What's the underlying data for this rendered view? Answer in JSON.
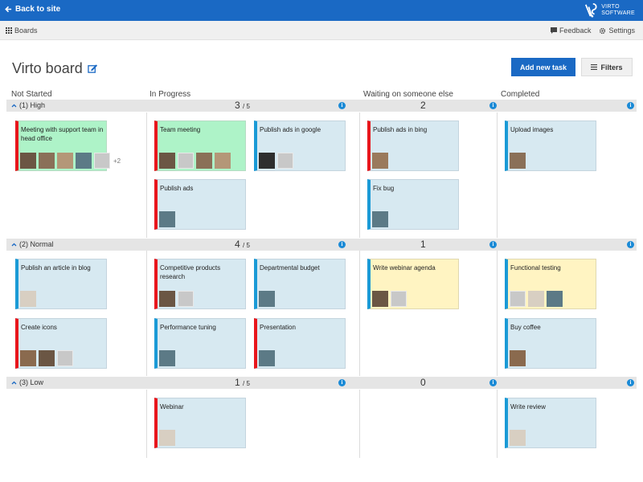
{
  "topbar": {
    "back_label": "Back to site",
    "logo_line1": "VIRTO",
    "logo_line2": "SOFTWARE",
    "color": "#1a69c4"
  },
  "subbar": {
    "boards_label": "Boards",
    "feedback_label": "Feedback",
    "settings_label": "Settings"
  },
  "board": {
    "title": "Virto board",
    "add_task_label": "Add new task",
    "filters_label": "Filters"
  },
  "columns": [
    "Not Started",
    "In Progress",
    "Waiting on someone else",
    "Completed"
  ],
  "lanes": [
    {
      "label": "(1) High",
      "in_progress_count": "3",
      "in_progress_limit": "/ 5",
      "waiting_count": "2"
    },
    {
      "label": "(2) Normal",
      "in_progress_count": "4",
      "in_progress_limit": "/ 5",
      "waiting_count": "1"
    },
    {
      "label": "(3) Low",
      "in_progress_count": "1",
      "in_progress_limit": "/ 5",
      "waiting_count": "0"
    }
  ],
  "cards": {
    "high_ns_1": {
      "title": "Meeting with support team in head office",
      "more": "+2"
    },
    "high_ip_1": {
      "title": "Team meeting"
    },
    "high_ip_2": {
      "title": "Publish ads in google"
    },
    "high_ip_3": {
      "title": "Publish ads"
    },
    "high_w_1": {
      "title": "Publish ads in bing"
    },
    "high_w_2": {
      "title": "Fix bug"
    },
    "high_c_1": {
      "title": "Upload images"
    },
    "norm_ns_1": {
      "title": "Publish an article in blog"
    },
    "norm_ns_2": {
      "title": "Create icons"
    },
    "norm_ip_1": {
      "title": "Competitive products research"
    },
    "norm_ip_2": {
      "title": "Departmental budget"
    },
    "norm_ip_3": {
      "title": "Performance tuning"
    },
    "norm_ip_4": {
      "title": "Presentation"
    },
    "norm_w_1": {
      "title": "Write webinar agenda"
    },
    "norm_c_1": {
      "title": "Functional testing"
    },
    "norm_c_2": {
      "title": "Buy coffee"
    },
    "low_ip_1": {
      "title": "Webinar"
    },
    "low_c_1": {
      "title": "Write review"
    }
  },
  "colors": {
    "priority_high": "#e8161c",
    "priority_normal": "#1a9ad6",
    "card_blue": "#d7e9f1",
    "card_green": "#aef3c8",
    "card_yellow": "#fff4c2"
  }
}
